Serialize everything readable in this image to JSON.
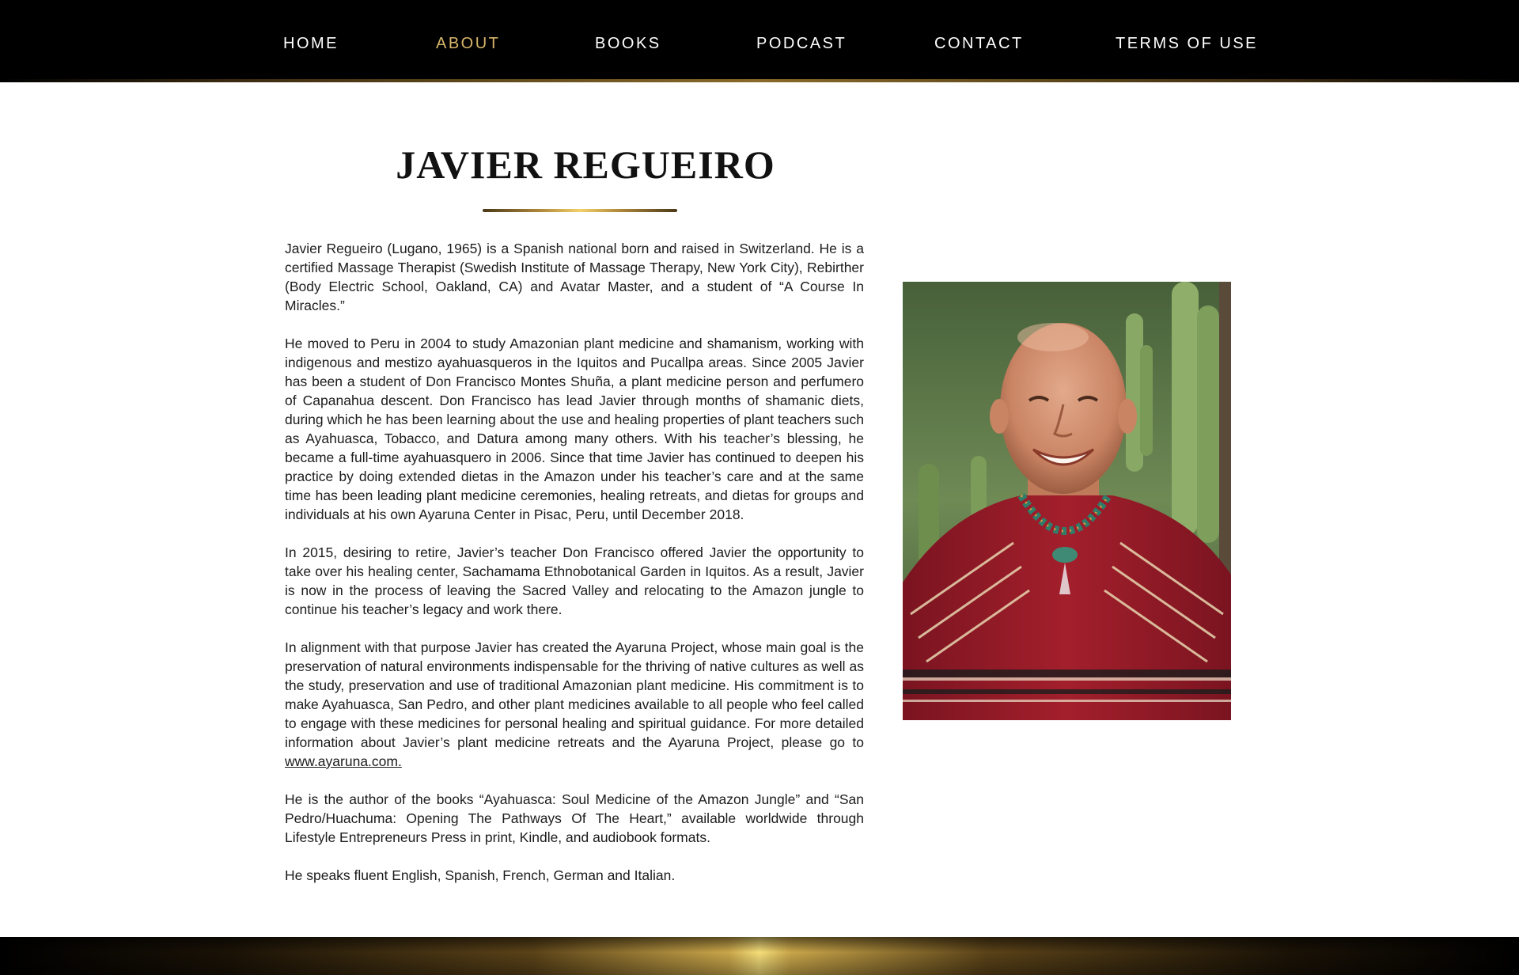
{
  "nav": {
    "items": [
      {
        "label": "HOME",
        "active": false
      },
      {
        "label": "ABOUT",
        "active": true
      },
      {
        "label": "BOOKS",
        "active": false
      },
      {
        "label": "PODCAST",
        "active": false
      },
      {
        "label": "CONTACT",
        "active": false
      },
      {
        "label": "TERMS OF USE",
        "active": false
      }
    ],
    "active_color": "#d8b66a",
    "background_color": "#000000"
  },
  "page": {
    "title": "JAVIER REGUEIRO",
    "accent_gold": "#d8b66a"
  },
  "bio": {
    "p1": "Javier Regueiro (Lugano, 1965) is a Spanish national born and raised in Switzerland. He is a certified Massage Therapist (Swedish Institute of Massage Therapy, New York City), Rebirther (Body Electric School, Oakland, CA) and Avatar Master, and a student of “A Course In Miracles.”",
    "p2": "He moved to Peru in 2004 to study Amazonian plant medicine and shamanism, working with indigenous and mestizo ayahuasqueros in the Iquitos and Pucallpa areas. Since 2005 Javier has been a student of Don Francisco Montes Shuña, a plant medicine person and perfumero of Capanahua descent. Don Francisco has lead Javier through months of shamanic diets, during which he has been learning about the use and healing properties of plant teachers such as Ayahuasca, Tobacco, and Datura among many others. With his teacher’s blessing, he became a full-time ayahuasquero in 2006. Since that time Javier has continued to deepen his practice by doing extended dietas in the Amazon under his teacher’s care and at the same time has been leading plant medicine ceremonies, healing retreats, and dietas for groups and individuals at his own Ayaruna Center in Pisac, Peru, until December 2018.",
    "p3": "In 2015, desiring to retire, Javier’s teacher Don Francisco offered Javier the opportunity to take over his healing center, Sachamama Ethnobotanical Garden in Iquitos. As a result, Javier is now in the process of leaving the Sacred Valley and relocating to the Amazon jungle to continue his teacher’s legacy and work there.",
    "p4": "In alignment with that purpose Javier has created the Ayaruna Project, whose main goal is the preservation of natural environments indispensable for the thriving of native cultures as well as the study, preservation and use of traditional Amazonian plant medicine. His commitment is to make Ayahuasca, San Pedro, and other plant medicines available to all people who feel called to engage with these medicines for personal healing and spiritual guidance. For more detailed information about Javier’s plant medicine retreats and the Ayaruna Project, please go to",
    "p4_link": "www.ayaruna.com.",
    "p5": "He is the author of the books “Ayahuasca: Soul Medicine of the Amazon Jungle” and “San Pedro/Huachuma: Opening The Pathways Of The Heart,” available worldwide through Lifestyle Entrepreneurs Press in print, Kindle, and audiobook formats.",
    "p6": "He speaks fluent English, Spanish, French, German and Italian."
  },
  "photo": {
    "icon": "portrait-photo"
  }
}
